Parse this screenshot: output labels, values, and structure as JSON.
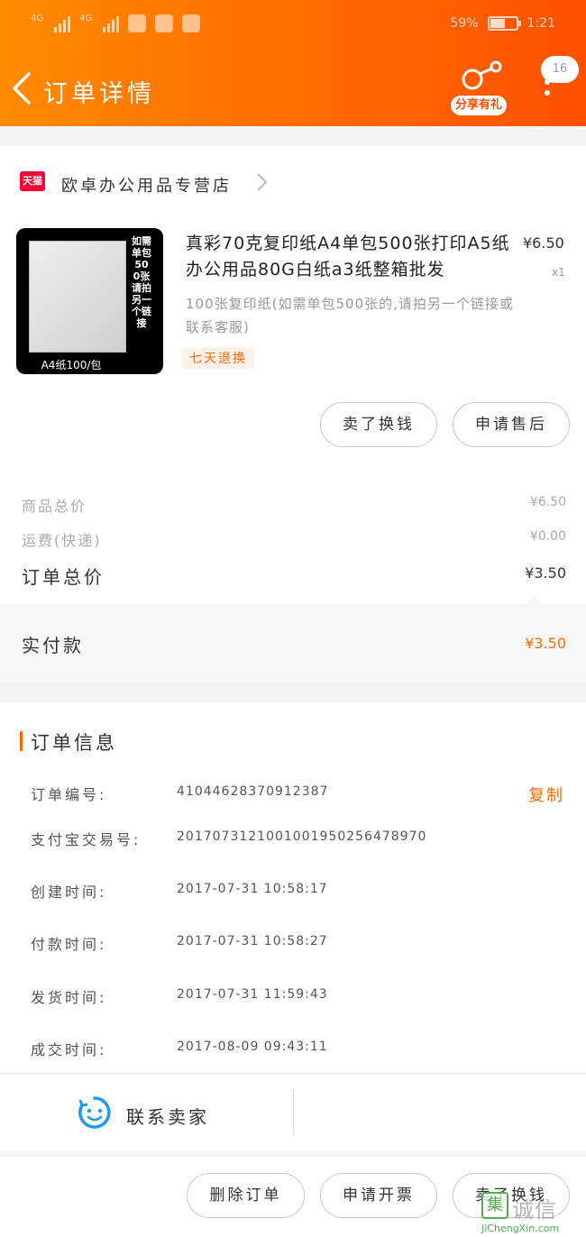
{
  "status_bar": {
    "signal1_label": "4G",
    "signal2_label": "4G",
    "battery_percent": "59%",
    "battery_level": 0.59,
    "time": "1:21"
  },
  "header": {
    "title": "订单详情",
    "share_label": "分享有礼",
    "message_count": "16"
  },
  "shop": {
    "badge": "天猫",
    "name": "欧卓办公用品专营店"
  },
  "product": {
    "image_side_text": "如需单包500张请拍另一个链接",
    "image_bottom_text": "A4纸100/包",
    "title": "真彩70克复印纸A4单包500张打印A5纸办公用品80G白纸a3纸整箱批发",
    "price": "¥6.50",
    "quantity": "x1",
    "sku": "100张复印纸(如需单包500张的,请拍另一个链接或联系客服)",
    "return_tag": "七天退换"
  },
  "item_actions": {
    "sell_label": "卖了换钱",
    "aftersale_label": "申请售后"
  },
  "summary": {
    "goods_total_label": "商品总价",
    "goods_total_value": "¥6.50",
    "shipping_label": "运费(快递)",
    "shipping_value": "¥0.00",
    "order_total_label": "订单总价",
    "order_total_value": "¥3.50",
    "paid_label": "实付款",
    "paid_value": "¥3.50"
  },
  "order_info": {
    "title": "订单信息",
    "copy_label": "复制",
    "rows": [
      {
        "label": "订单编号:",
        "value": "41044628370912387"
      },
      {
        "label": "支付宝交易号:",
        "value": "2017073121001001950256478970"
      },
      {
        "label": "创建时间:",
        "value": "2017-07-31 10:58:17"
      },
      {
        "label": "付款时间:",
        "value": "2017-07-31 10:58:27"
      },
      {
        "label": "发货时间:",
        "value": "2017-07-31 11:59:43"
      },
      {
        "label": "成交时间:",
        "value": "2017-08-09 09:43:11"
      }
    ]
  },
  "contact": {
    "label": "联系卖家"
  },
  "bottom_actions": {
    "delete_label": "删除订单",
    "invoice_label": "申请开票",
    "sell_label": "卖了换钱"
  },
  "watermark": {
    "icon_char": "集",
    "name": "诚信",
    "url": "JiChengXin.com"
  },
  "colors": {
    "brand_orange": "#ff6a00",
    "tmall_red": "#ff0036"
  }
}
